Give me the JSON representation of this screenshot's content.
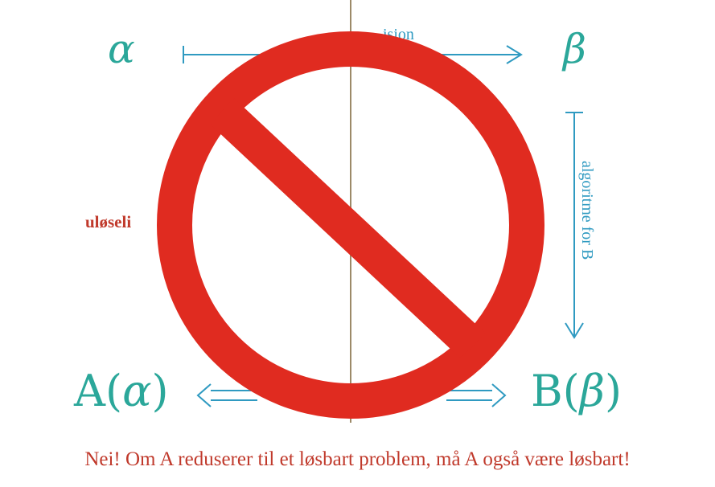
{
  "labels": {
    "alpha": "α",
    "beta": "β",
    "a_alpha_prefix": "A(",
    "a_alpha_var": "α",
    "a_alpha_suffix": ")",
    "b_beta_prefix": "B(",
    "b_beta_var": "β",
    "b_beta_suffix": ")",
    "reduction_fragment": "ision",
    "algorithm_for_b": "algoritme for B",
    "unsolvable_fragment": "uløseli",
    "caption": "Nei! Om A reduserer til et løsbart problem, må A også være løsbart!"
  },
  "colors": {
    "math": "#2ba79a",
    "arrows": "#2f9ac1",
    "emphasis": "#c0392b",
    "prohibition_sign": "#e02b20",
    "divider": "#9c8a68"
  },
  "icons": {
    "overlay": "prohibition-sign-icon"
  }
}
